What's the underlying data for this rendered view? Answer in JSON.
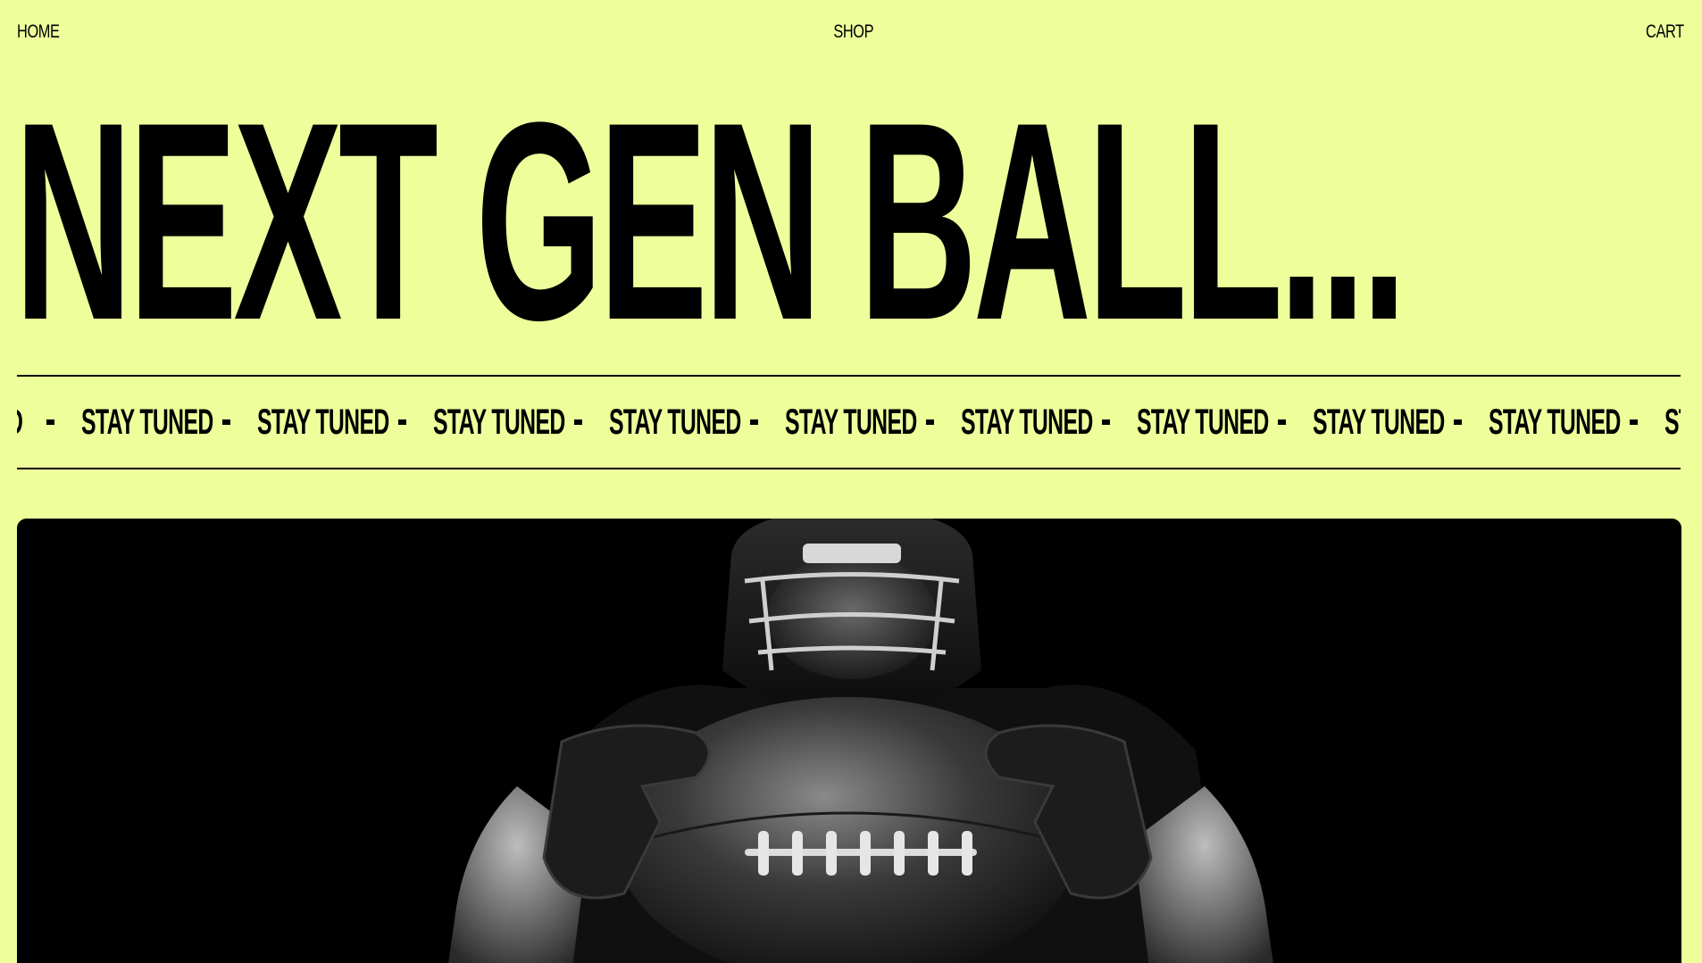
{
  "nav": {
    "home_label": "HOME",
    "shop_label": "SHOP",
    "cart_label": "CART"
  },
  "hero": {
    "title": "NEXT GEN BALL..."
  },
  "ticker": {
    "leading_fragment": "D",
    "items": [
      "STAY TUNED",
      "STAY TUNED",
      "STAY TUNED",
      "STAY TUNED",
      "STAY TUNED",
      "STAY TUNED",
      "STAY TUNED",
      "STAY TUNED",
      "STAY TUNED"
    ],
    "trailing_fragment": "ST"
  },
  "media": {
    "subject": "american-football-player-holding-ball",
    "background": "#000000"
  },
  "colors": {
    "background": "#eefe9b",
    "text": "#000000"
  }
}
